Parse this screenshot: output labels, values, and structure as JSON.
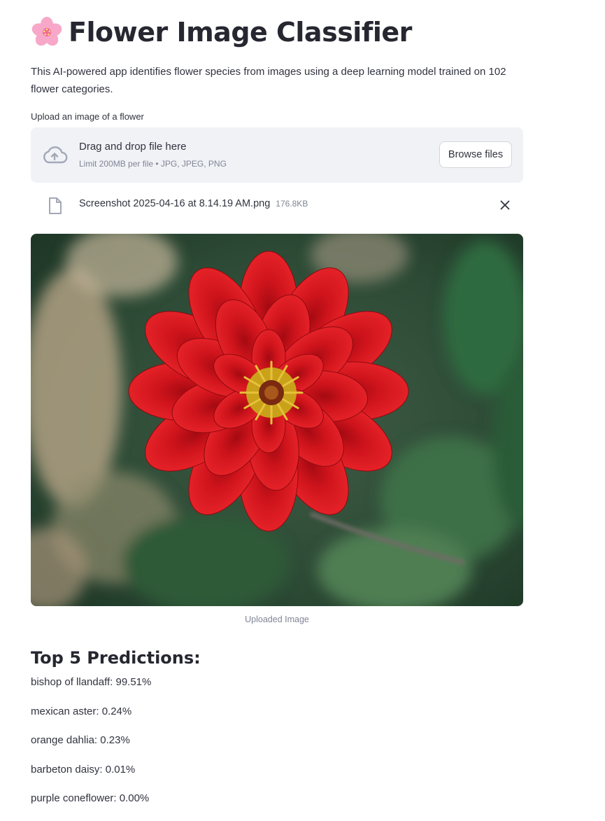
{
  "header": {
    "title": "Flower Image Classifier",
    "emoji_icon": "cherry-blossom-icon"
  },
  "description": "This AI-powered app identifies flower species from images using a deep learning model trained on 102 flower categories.",
  "uploader": {
    "label": "Upload an image of a flower",
    "drop_text": "Drag and drop file here",
    "limit_text": "Limit 200MB per file • JPG, JPEG, PNG",
    "browse_label": "Browse files",
    "icon": "cloud-upload-icon"
  },
  "uploaded_file": {
    "name": "Screenshot 2025-04-16 at 8.14.19 AM.png",
    "size": "176.8KB",
    "icon": "file-icon",
    "remove_icon": "close-icon"
  },
  "image": {
    "caption": "Uploaded Image"
  },
  "predictions": {
    "heading": "Top 5 Predictions:",
    "items": [
      "bishop of llandaff: 99.51%",
      "mexican aster: 0.24%",
      "orange dahlia: 0.23%",
      "barbeton daisy: 0.01%",
      "purple coneflower: 0.00%"
    ]
  },
  "colors": {
    "dropzone_bg": "#f0f2f6",
    "text": "#31333f",
    "muted": "#808495",
    "flower_red": "#d0141c"
  }
}
